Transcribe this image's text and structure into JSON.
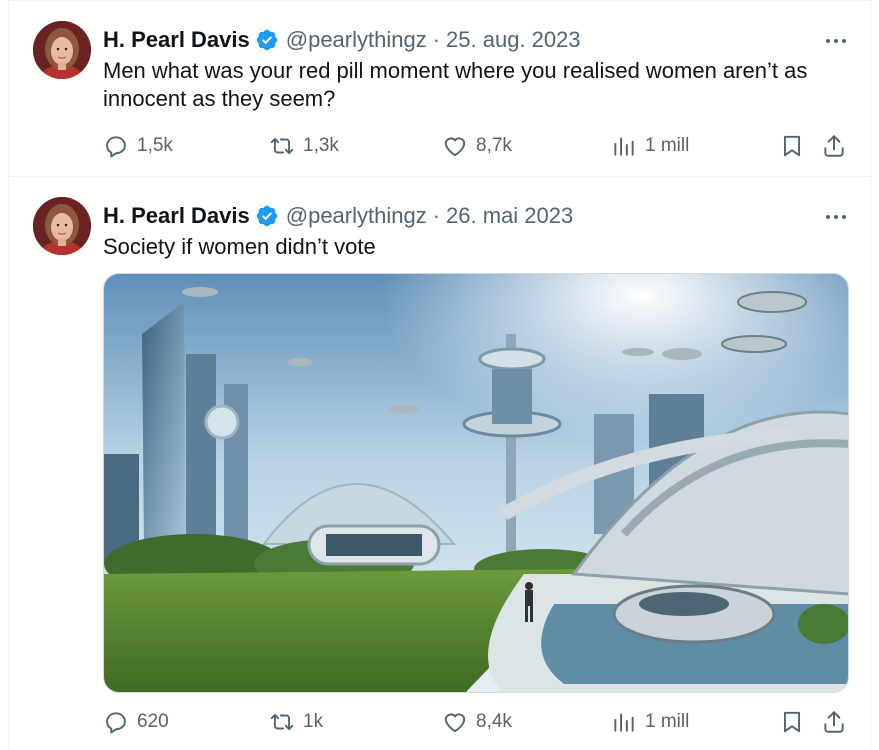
{
  "tweets": [
    {
      "name": "H. Pearl Davis",
      "handle": "@pearlythingz",
      "separator": "·",
      "date": "25. aug. 2023",
      "text": "Men what was your red pill moment where you realised women aren’t as innocent as they seem?",
      "replies": "1,5k",
      "retweets": "1,3k",
      "likes": "8,7k",
      "views": "1 mill"
    },
    {
      "name": "H. Pearl Davis",
      "handle": "@pearlythingz",
      "separator": "·",
      "date": "26. mai 2023",
      "text": "Society if women didn’t vote",
      "replies": "620",
      "retweets": "1k",
      "likes": "8,4k",
      "views": "1 mill",
      "has_media": true
    }
  ],
  "icons": {
    "verified": "verified-badge-icon",
    "more": "more-options-icon",
    "reply": "reply-icon",
    "retweet": "retweet-icon",
    "like": "heart-icon",
    "views": "analytics-icon",
    "bookmark": "bookmark-icon",
    "share": "share-icon"
  },
  "colors": {
    "verified_blue": "#1d9bf0",
    "secondary_text": "#536471",
    "primary_text": "#0f1419",
    "divider": "#eff3f4"
  }
}
